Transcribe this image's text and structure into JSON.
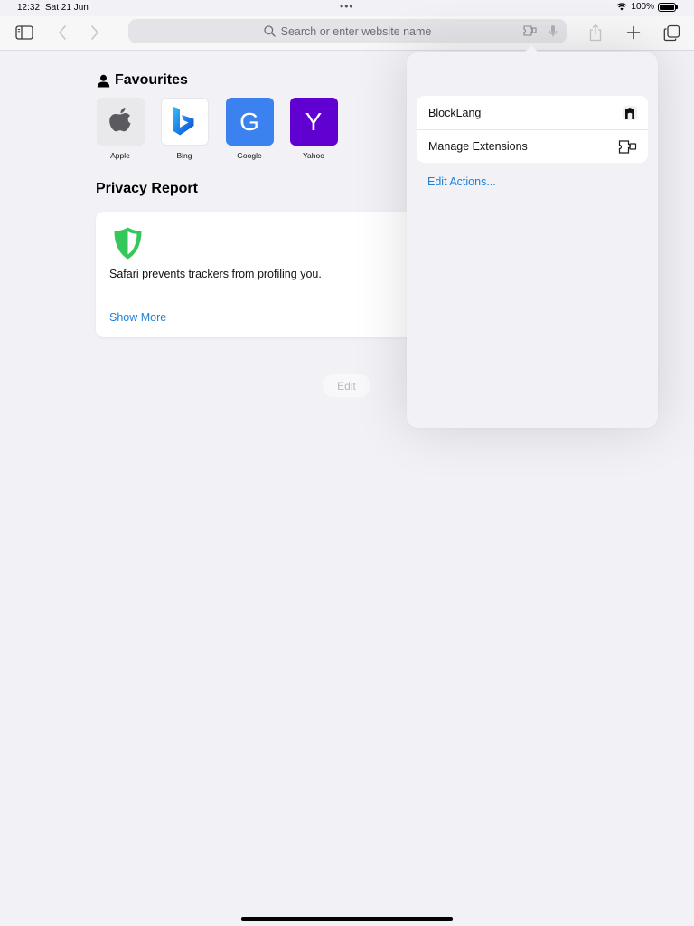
{
  "status_bar": {
    "time": "12:32",
    "date": "Sat 21 Jun",
    "dots": "•••",
    "battery": "100%",
    "battery_level": 1.0
  },
  "toolbar": {
    "address_placeholder": "Search or enter website name",
    "icons": [
      "sidebar-icon",
      "back-icon",
      "forward-icon",
      "search-icon",
      "extension-icon",
      "microphone-icon",
      "share-icon",
      "plus-icon",
      "tabs-icon"
    ]
  },
  "favourites": {
    "title": "Favourites",
    "items": [
      {
        "label": "Apple",
        "glyph": ""
      },
      {
        "label": "Bing",
        "glyph": ""
      },
      {
        "label": "Google",
        "glyph": "G"
      },
      {
        "label": "Yahoo",
        "glyph": "Y"
      }
    ]
  },
  "privacy": {
    "title": "Privacy Report",
    "message": "Safari prevents trackers from profiling you.",
    "show_more": "Show More"
  },
  "edit_label": "Edit",
  "popover": {
    "items": [
      {
        "label": "BlockLang",
        "icon": "blocklang-icon"
      },
      {
        "label": "Manage Extensions",
        "icon": "extension-puzzle-icon"
      }
    ],
    "edit_actions": "Edit Actions..."
  },
  "colors": {
    "accent": "#1c7fd8",
    "background": "#f2f1f6",
    "shield": "#34c759",
    "google_tile": "#3b82f0",
    "yahoo_tile": "#6001d2"
  }
}
